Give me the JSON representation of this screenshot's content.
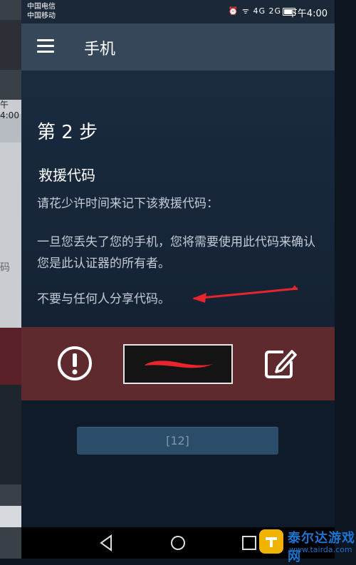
{
  "background_app": {
    "time_text": "午4:00",
    "partial_text": "码"
  },
  "status_bar": {
    "carrier_1": "中国电信",
    "carrier_2": "中国移动",
    "icons_text": "⏰ ᯤ 4G 2G",
    "time": "下午4:00"
  },
  "app_bar": {
    "title": "手机"
  },
  "content": {
    "step_title": "第 2 步",
    "section_title": "救援代码",
    "paragraph_1": "请花少许时间来记下该救援代码：",
    "paragraph_2": "一旦您丢失了您的手机，您将需要使用此代码来确认您是此认证器的所有者。",
    "paragraph_3": "不要与任何人分享代码。"
  },
  "code_bar": {
    "code_value": ""
  },
  "lower": {
    "hint_button_label": "[12]"
  },
  "watermark": {
    "name": "泰尔达游戏网",
    "url": "www.tairda.com"
  },
  "colors": {
    "app_bar": "#37475a",
    "code_bar": "#5e2a2e",
    "accent_red": "#e8242c",
    "watermark_blue": "#1a75d2"
  }
}
